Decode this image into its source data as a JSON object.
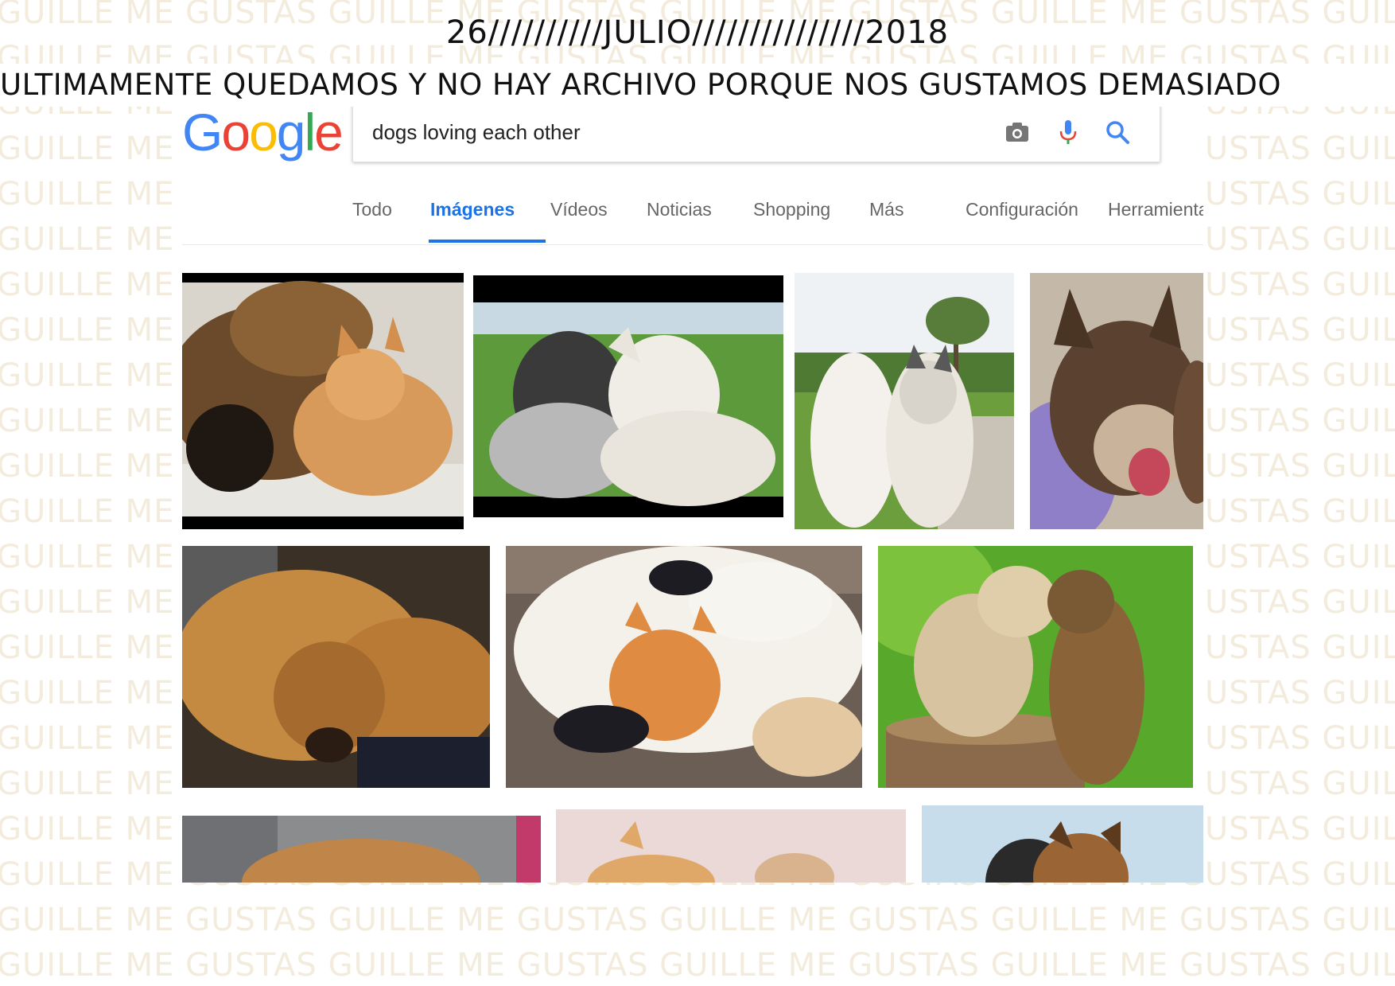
{
  "watermark_text": "GUILLE ME GUSTAS",
  "header": {
    "date": "26//////////JULIO///////////////2018",
    "headline": "ULTIMAMENTE QUEDAMOS Y NO HAY ARCHIVO PORQUE NOS GUSTAMOS DEMASIADO"
  },
  "google": {
    "logo_letters": [
      "G",
      "o",
      "o",
      "g",
      "l",
      "e"
    ],
    "search_query": "dogs loving each other",
    "tabs": [
      {
        "label": "Todo",
        "active": false
      },
      {
        "label": "Imágenes",
        "active": true
      },
      {
        "label": "Vídeos",
        "active": false
      },
      {
        "label": "Noticias",
        "active": false
      },
      {
        "label": "Shopping",
        "active": false
      },
      {
        "label": "Más",
        "active": false
      },
      {
        "label": "Configuración",
        "active": false
      },
      {
        "label": "Herramientas",
        "active": false
      }
    ],
    "icons": [
      "camera-icon",
      "microphone-icon",
      "search-icon"
    ]
  },
  "results": [
    {
      "subject": "german shepherd and orange cat"
    },
    {
      "subject": "two dogs hugging on grass"
    },
    {
      "subject": "white dog kissing husky"
    },
    {
      "subject": "husky puppies smiling"
    },
    {
      "subject": "golden retrievers sleeping together"
    },
    {
      "subject": "dog hugging orange cat"
    },
    {
      "subject": "puppies touching noses"
    },
    {
      "subject": "puppy on pavement"
    },
    {
      "subject": "puppy and kitten"
    },
    {
      "subject": "dogs cuddling"
    }
  ],
  "colors": {
    "accent": "#1a73e8",
    "watermark": "#f3ecdd",
    "google_blue": "#4285f4",
    "google_red": "#ea4335",
    "google_yellow": "#fbbc05",
    "google_green": "#34a853"
  }
}
